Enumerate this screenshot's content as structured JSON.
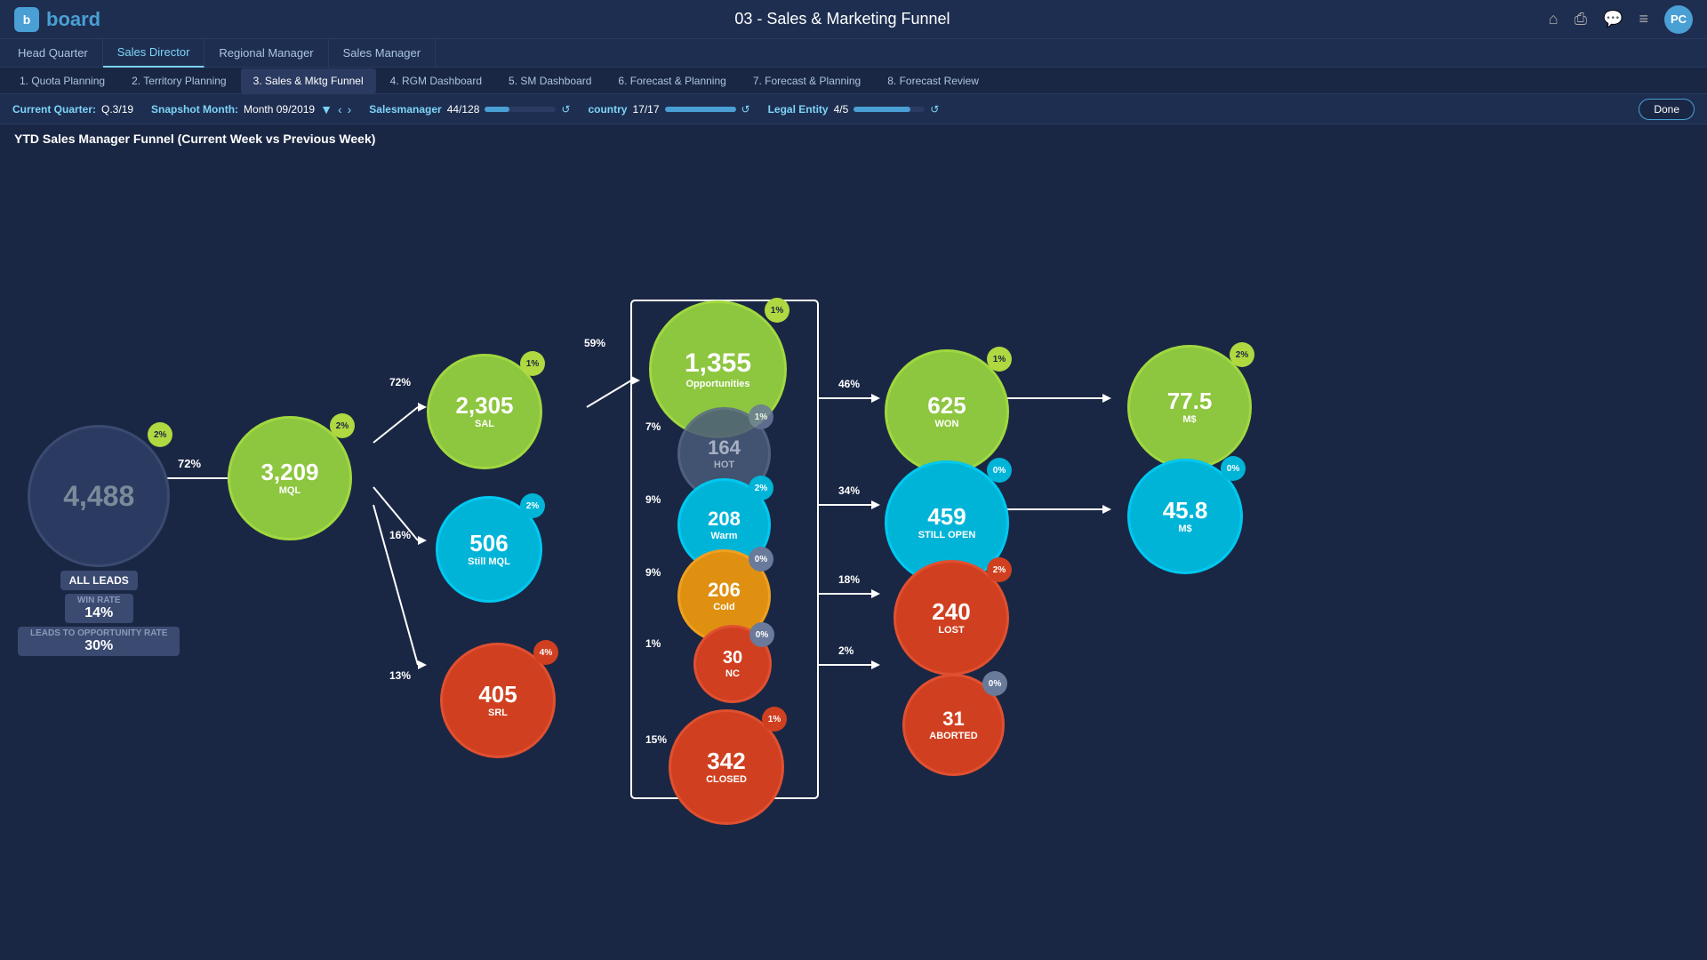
{
  "topbar": {
    "logo_letter": "b",
    "logo_word": "board",
    "page_title": "03 - Sales & Marketing Funnel",
    "user_initials": "PC"
  },
  "nav_tabs": [
    {
      "label": "Head Quarter",
      "active": false
    },
    {
      "label": "Sales Director",
      "active": true
    },
    {
      "label": "Regional Manager",
      "active": false
    },
    {
      "label": "Sales Manager",
      "active": false
    }
  ],
  "sub_nav": [
    {
      "label": "1. Quota Planning"
    },
    {
      "label": "2. Territory Planning"
    },
    {
      "label": "3. Sales & Mktg Funnel",
      "active": true
    },
    {
      "label": "4. RGM Dashboard"
    },
    {
      "label": "5. SM Dashboard"
    },
    {
      "label": "6. Forecast & Planning"
    },
    {
      "label": "7. Forecast & Planning"
    },
    {
      "label": "8. Forecast Review"
    }
  ],
  "filter_bar": {
    "current_quarter_label": "Current Quarter:",
    "current_quarter_val": "Q.3/19",
    "snapshot_label": "Snapshot Month:",
    "snapshot_val": "Month 09/2019",
    "salesmanager_label": "Salesmanager",
    "salesmanager_val": "44/128",
    "country_label": "country",
    "country_val": "17/17",
    "legal_entity_label": "Legal Entity",
    "legal_entity_val": "4/5",
    "done_label": "Done"
  },
  "chart_title": "YTD Sales Manager Funnel (Current Week vs Previous Week)",
  "nodes": {
    "all_leads": {
      "value": "4,488",
      "label": "ALL LEADS",
      "badge": "2%",
      "win_rate_label": "WIN RATE",
      "win_rate_val": "14%",
      "leads_label": "LEADS TO OPPORTUNITY RATE",
      "leads_val": "30%"
    },
    "mql": {
      "value": "3,209",
      "label": "MQL",
      "badge": "2%",
      "pct": "72%"
    },
    "sal": {
      "value": "2,305",
      "label": "SAL",
      "badge": "1%",
      "pct": "72%"
    },
    "still_mql": {
      "value": "506",
      "label": "Still MQL",
      "badge": "2%",
      "pct": "16%"
    },
    "srl": {
      "value": "405",
      "label": "SRL",
      "badge": "4%",
      "pct": "13%"
    },
    "opportunities": {
      "value": "1,355",
      "label": "Opportunities",
      "badge": "1%",
      "pct": "59%"
    },
    "hot": {
      "value": "164",
      "label": "HOT",
      "badge": "1%",
      "pct": "7%"
    },
    "warm": {
      "value": "208",
      "label": "Warm",
      "badge": "2%",
      "pct": "9%"
    },
    "cold": {
      "value": "206",
      "label": "Cold",
      "badge": "0%",
      "pct": "9%"
    },
    "nc": {
      "value": "30",
      "label": "NC",
      "badge": "0%",
      "pct": "1%"
    },
    "closed": {
      "value": "342",
      "label": "CLOSED",
      "badge": "1%",
      "pct": "15%"
    },
    "won": {
      "value": "625",
      "label": "WON",
      "badge": "1%",
      "pct": "46%"
    },
    "won_ms": {
      "value": "77.5",
      "label": "M$",
      "badge": "2%"
    },
    "still_open": {
      "value": "459",
      "label": "STILL OPEN",
      "badge": "0%",
      "pct": "34%"
    },
    "still_open_ms": {
      "value": "45.8",
      "label": "M$",
      "badge": "0%"
    },
    "lost": {
      "value": "240",
      "label": "LOST",
      "badge": "2%",
      "pct": "18%"
    },
    "aborted": {
      "value": "31",
      "label": "ABORTED",
      "badge": "0%",
      "pct": "2%"
    }
  }
}
